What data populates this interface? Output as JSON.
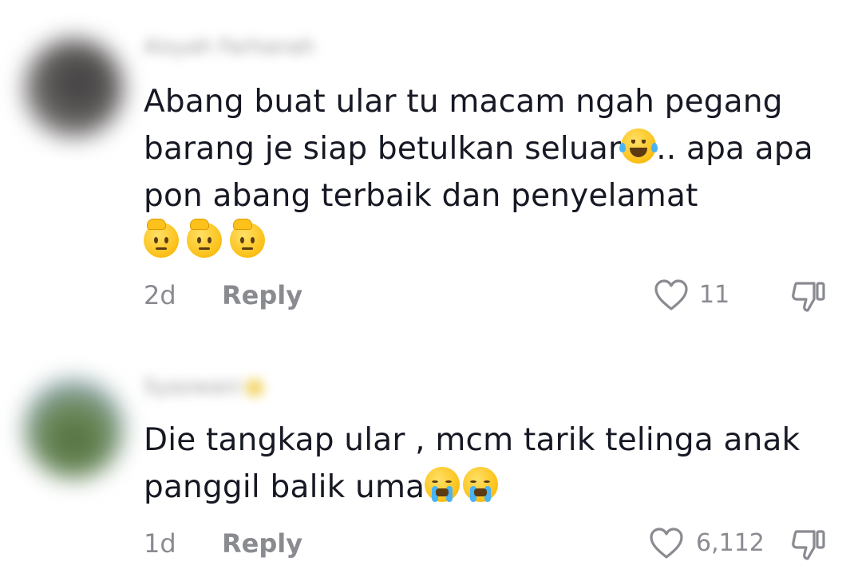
{
  "comments": [
    {
      "username": "Aisyah Farhanah",
      "avatar_icon": "blurred-avatar",
      "text_parts": [
        "Abang buat ular tu macam ngah pegang barang je siap betulkan seluar",
        ".. apa apa pon abang terbaik dan penyelamat"
      ],
      "emoji": [
        "face-with-tears-of-joy",
        "saluting-face",
        "saluting-face",
        "saluting-face"
      ],
      "time": "2d",
      "reply_label": "Reply",
      "likes": "11",
      "like_icon": "heart-outline-icon",
      "dislike_icon": "thumbs-down-icon"
    },
    {
      "username": "Syazwani",
      "avatar_icon": "blurred-avatar",
      "text_parts": [
        "Die tangkap ular , mcm tarik telinga anak panggil balik uma"
      ],
      "emoji": [
        "loudly-crying-face",
        "loudly-crying-face"
      ],
      "time": "1d",
      "reply_label": "Reply",
      "likes": "6,112",
      "like_icon": "heart-outline-icon",
      "dislike_icon": "thumbs-down-icon"
    }
  ],
  "colors": {
    "text": "#161823",
    "meta": "#8a8b91",
    "background": "#ffffff"
  }
}
